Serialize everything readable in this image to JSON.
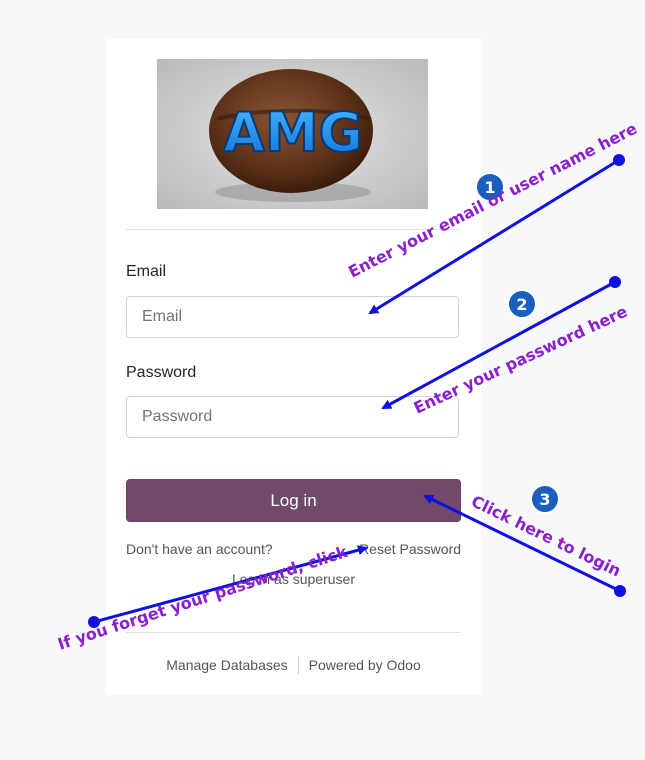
{
  "logo": {
    "text": "AMG"
  },
  "login_form": {
    "email_label": "Email",
    "email_placeholder": "Email",
    "password_label": "Password",
    "password_placeholder": "Password",
    "login_button": "Log in",
    "signup_link": "Don't have an account?",
    "reset_link": "Reset Password",
    "superuser_link": "Log in as superuser"
  },
  "footer": {
    "manage_databases": "Manage Databases",
    "powered_by": "Powered by Odoo"
  },
  "annotations": {
    "step1_number": "1",
    "step1_text": "Enter your email or user name here",
    "step2_number": "2",
    "step2_text": "Enter your password here",
    "step3_number": "3",
    "step3_text": "Click here to login",
    "forget_text": "If you forget your password, click",
    "arrow_color": "#1010e0",
    "text_color": "#8a1fd0",
    "badge_color": "#1a5fbf"
  },
  "colors": {
    "brand": "#71496b",
    "background": "#f7f8fa"
  }
}
